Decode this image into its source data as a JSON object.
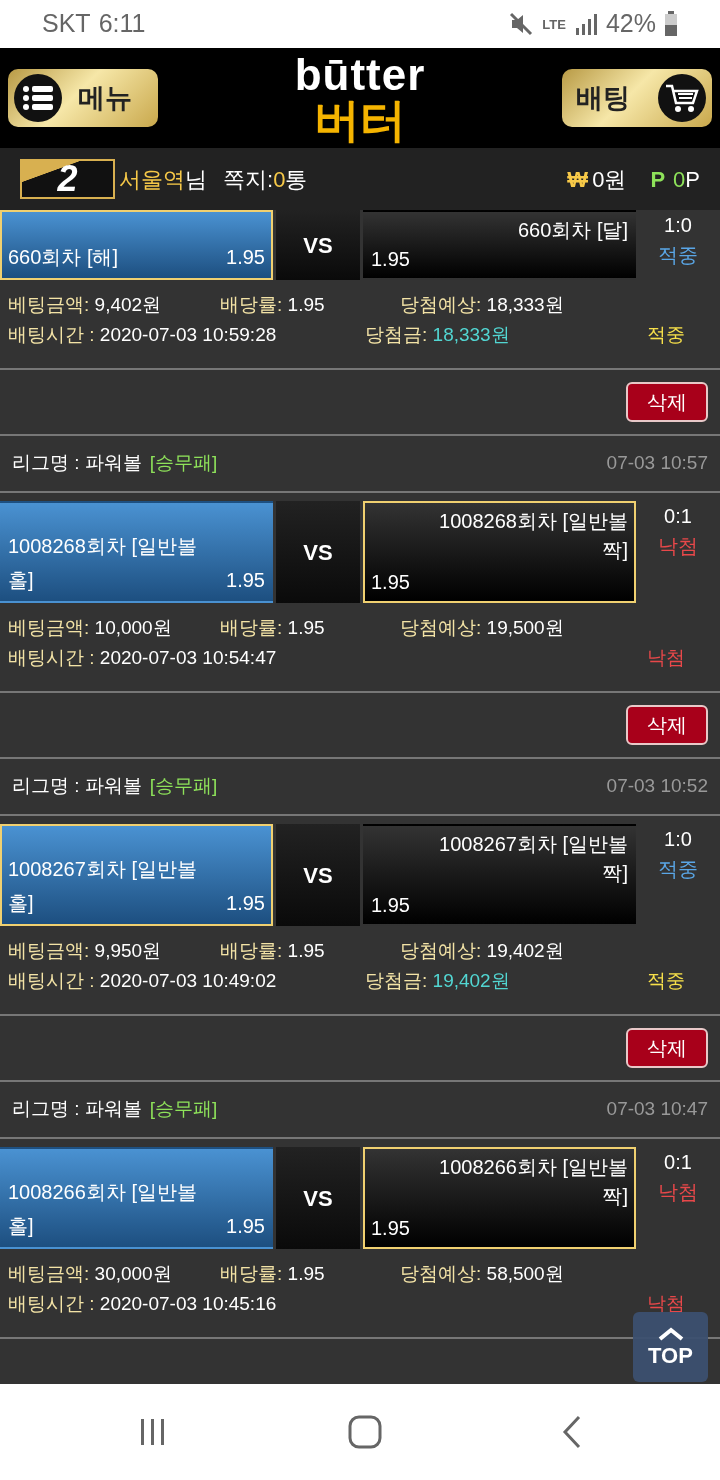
{
  "status_bar": {
    "carrier": "SKT",
    "time": "6:11",
    "network": "LTE",
    "battery": "42%"
  },
  "header": {
    "menu_button": "메뉴",
    "logo_top": "būtter",
    "logo_bottom": "버터",
    "bet_button": "배팅"
  },
  "user_bar": {
    "level": "2",
    "name": "서울역",
    "name_suffix": "님",
    "message_label": "쪽지:",
    "message_count": "0",
    "message_unit": "통",
    "currency_symbol": "₩",
    "balance": "0원",
    "point_symbol": "P",
    "points_value": "0",
    "points_unit": "P"
  },
  "bets": [
    {
      "home": {
        "name": "660회차 [해]",
        "odds": "1.95",
        "selected": true
      },
      "vs": "VS",
      "away": {
        "name": "660회차 [달]",
        "odds": "1.95",
        "selected": false
      },
      "score": "1:0",
      "result": "적중",
      "kind": "won",
      "amount_label": "베팅금액:",
      "amount": "9,402원",
      "odds_label": "배당률:",
      "odds": "1.95",
      "expected_label": "당첨예상:",
      "expected": "18,333원",
      "time_label": "배팅시간 :",
      "time": "2020-07-03 10:59:28",
      "payout_label": "당첨금:",
      "payout": "18,333원",
      "result_bottom": "적중",
      "delete_button": "삭제"
    },
    {
      "league_label": "리그명 : 파워볼",
      "league_type": "[승무패]",
      "date": "07-03 10:57",
      "home": {
        "name": "1008268회차 [일반볼 홀]",
        "odds": "1.95",
        "selected": false
      },
      "vs": "VS",
      "away": {
        "name": "1008268회차 [일반볼 짝]",
        "odds": "1.95",
        "selected": true
      },
      "score": "0:1",
      "result": "낙첨",
      "kind": "lost",
      "amount_label": "베팅금액:",
      "amount": "10,000원",
      "odds_label": "배당률:",
      "odds": "1.95",
      "expected_label": "당첨예상:",
      "expected": "19,500원",
      "time_label": "배팅시간 :",
      "time": "2020-07-03 10:54:47",
      "result_bottom": "낙첨",
      "delete_button": "삭제"
    },
    {
      "league_label": "리그명 : 파워볼",
      "league_type": "[승무패]",
      "date": "07-03 10:52",
      "home": {
        "name": "1008267회차 [일반볼 홀]",
        "odds": "1.95",
        "selected": true
      },
      "vs": "VS",
      "away": {
        "name": "1008267회차 [일반볼 짝]",
        "odds": "1.95",
        "selected": false
      },
      "score": "1:0",
      "result": "적중",
      "kind": "won",
      "amount_label": "베팅금액:",
      "amount": "9,950원",
      "odds_label": "배당률:",
      "odds": "1.95",
      "expected_label": "당첨예상:",
      "expected": "19,402원",
      "time_label": "배팅시간 :",
      "time": "2020-07-03 10:49:02",
      "payout_label": "당첨금:",
      "payout": "19,402원",
      "result_bottom": "적중",
      "delete_button": "삭제"
    },
    {
      "league_label": "리그명 : 파워볼",
      "league_type": "[승무패]",
      "date": "07-03 10:47",
      "home": {
        "name": "1008266회차 [일반볼 홀]",
        "odds": "1.95",
        "selected": false
      },
      "vs": "VS",
      "away": {
        "name": "1008266회차 [일반볼 짝]",
        "odds": "1.95",
        "selected": true
      },
      "score": "0:1",
      "result": "낙첨",
      "kind": "lost",
      "amount_label": "베팅금액:",
      "amount": "30,000원",
      "odds_label": "배당률:",
      "odds": "1.95",
      "expected_label": "당첨예상:",
      "expected": "58,500원",
      "time_label": "배팅시간 :",
      "time": "2020-07-03 10:45:16",
      "result_bottom": "낙첨"
    }
  ],
  "top_button": "TOP"
}
